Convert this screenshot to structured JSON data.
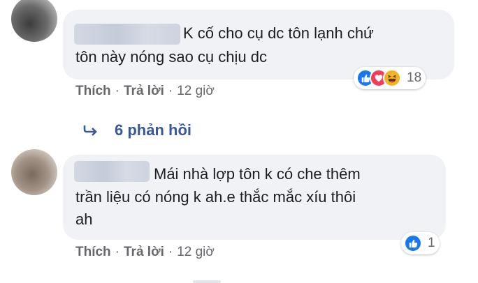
{
  "comments": [
    {
      "text_line1": "K cố cho cụ dc tôn lạnh chứ",
      "text_line2": "tôn này nóng sao cụ chịu dc",
      "reactions": [
        "like-icon",
        "love-icon",
        "haha-icon"
      ],
      "reaction_count": "18",
      "like_label": "Thích",
      "reply_label": "Trả lời",
      "separator": "·",
      "time": "12 giờ",
      "replies_label": "6 phản hồi"
    },
    {
      "text_line1": "Mái nhà lợp tôn k có che thêm",
      "text_line2": "trần liệu có nóng k ah.e thắc mắc xíu thôi",
      "text_line3": "ah",
      "reactions": [
        "like-icon"
      ],
      "reaction_count": "1",
      "like_label": "Thích",
      "reply_label": "Trả lời",
      "separator": "·",
      "time": "12 giờ"
    }
  ],
  "colors": {
    "bubble": "#f0f2f5",
    "text": "#1c1e21",
    "meta": "#65676b",
    "link": "#385898",
    "like": "#1877f2",
    "love": "#f33e58",
    "haha": "#f7b125"
  }
}
